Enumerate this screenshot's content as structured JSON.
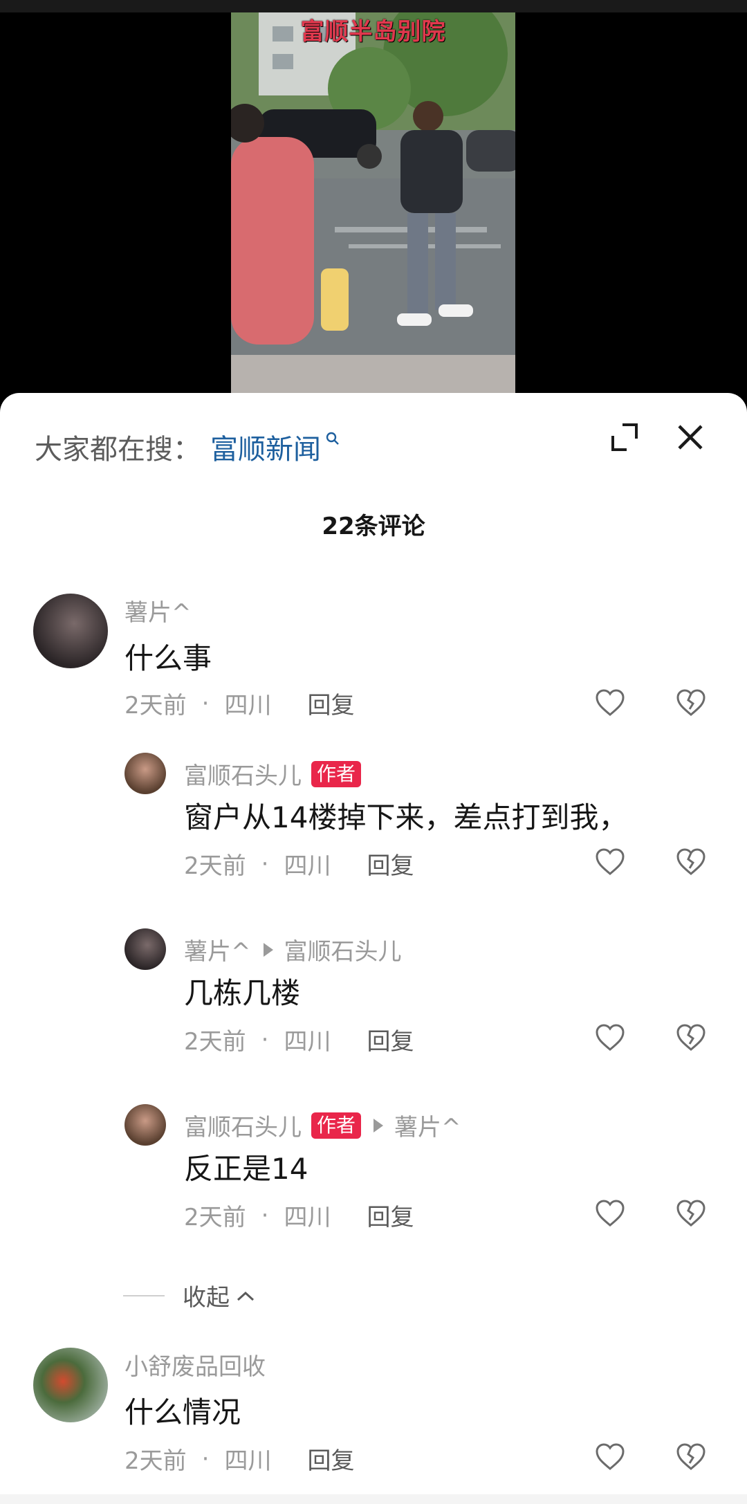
{
  "video": {
    "caption": "富顺半岛别院",
    "icons": [
      "street-scene"
    ]
  },
  "sheet": {
    "search_prefix": "大家都在搜：",
    "search_term": "富顺新闻",
    "count_title": "22条评论",
    "expand_icon": "expand-icon",
    "close_icon": "close-icon"
  },
  "comments": [
    {
      "user": "薯片^",
      "text": "什么事",
      "time": "2天前",
      "loc": "四川",
      "reply": "回复"
    },
    {
      "user": "富顺石头儿",
      "badge": "作者",
      "text": "窗户从14楼掉下来，差点打到我，",
      "time": "2天前",
      "loc": "四川",
      "reply": "回复"
    },
    {
      "user": "薯片^",
      "target": "富顺石头儿",
      "text": "几栋几楼",
      "time": "2天前",
      "loc": "四川",
      "reply": "回复"
    },
    {
      "user": "富顺石头儿",
      "badge": "作者",
      "target": "薯片^",
      "text": "反正是14",
      "time": "2天前",
      "loc": "四川",
      "reply": "回复"
    },
    {
      "user": "小舒废品回收",
      "text": "什么情况",
      "time": "2天前",
      "loc": "四川",
      "reply": "回复"
    }
  ],
  "collapse_label": "收起",
  "colors": {
    "badge": "#e9264a",
    "search_term": "#1d5f9e"
  }
}
